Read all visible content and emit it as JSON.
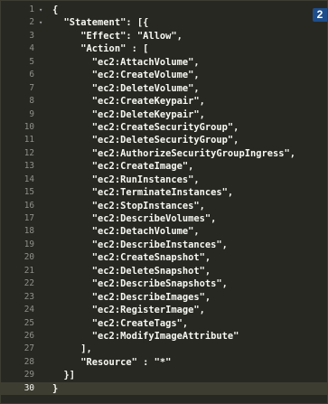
{
  "editor": {
    "badge": "2",
    "active_line": 30,
    "lines": [
      {
        "n": "1",
        "text": "{"
      },
      {
        "n": "2",
        "text": "  \"Statement\": [{"
      },
      {
        "n": "3",
        "text": "     \"Effect\": \"Allow\","
      },
      {
        "n": "4",
        "text": "     \"Action\" : ["
      },
      {
        "n": "5",
        "text": "       \"ec2:AttachVolume\","
      },
      {
        "n": "6",
        "text": "       \"ec2:CreateVolume\","
      },
      {
        "n": "7",
        "text": "       \"ec2:DeleteVolume\","
      },
      {
        "n": "8",
        "text": "       \"ec2:CreateKeypair\","
      },
      {
        "n": "9",
        "text": "       \"ec2:DeleteKeypair\","
      },
      {
        "n": "10",
        "text": "       \"ec2:CreateSecurityGroup\","
      },
      {
        "n": "11",
        "text": "       \"ec2:DeleteSecurityGroup\","
      },
      {
        "n": "12",
        "text": "       \"ec2:AuthorizeSecurityGroupIngress\","
      },
      {
        "n": "13",
        "text": "       \"ec2:CreateImage\","
      },
      {
        "n": "14",
        "text": "       \"ec2:RunInstances\","
      },
      {
        "n": "15",
        "text": "       \"ec2:TerminateInstances\","
      },
      {
        "n": "16",
        "text": "       \"ec2:StopInstances\","
      },
      {
        "n": "17",
        "text": "       \"ec2:DescribeVolumes\","
      },
      {
        "n": "18",
        "text": "       \"ec2:DetachVolume\","
      },
      {
        "n": "19",
        "text": "       \"ec2:DescribeInstances\","
      },
      {
        "n": "20",
        "text": "       \"ec2:CreateSnapshot\","
      },
      {
        "n": "21",
        "text": "       \"ec2:DeleteSnapshot\","
      },
      {
        "n": "22",
        "text": "       \"ec2:DescribeSnapshots\","
      },
      {
        "n": "23",
        "text": "       \"ec2:DescribeImages\","
      },
      {
        "n": "24",
        "text": "       \"ec2:RegisterImage\","
      },
      {
        "n": "25",
        "text": "       \"ec2:CreateTags\","
      },
      {
        "n": "26",
        "text": "       \"ec2:ModifyImageAttribute\""
      },
      {
        "n": "27",
        "text": "     ],"
      },
      {
        "n": "28",
        "text": "     \"Resource\" : \"*\""
      },
      {
        "n": "29",
        "text": "  }]"
      },
      {
        "n": "30",
        "text": "}"
      }
    ]
  }
}
